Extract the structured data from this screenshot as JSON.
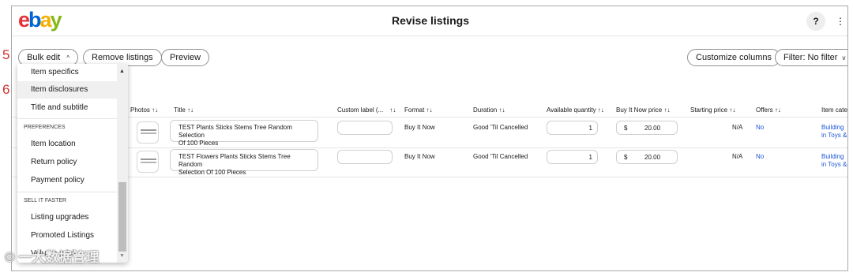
{
  "steps": [
    "5",
    "6"
  ],
  "header": {
    "logo": {
      "e": "e",
      "b": "b",
      "a": "a",
      "y": "y"
    },
    "title": "Revise listings",
    "help_label": "?",
    "more_label": "⋮"
  },
  "toolbar": {
    "bulk_edit": "Bulk edit",
    "bulk_edit_caret": "^",
    "remove_listings": "Remove listings",
    "preview": "Preview",
    "customize_columns": "Customize columns",
    "filter": "Filter: No filter",
    "filter_caret": "v"
  },
  "columns": {
    "photos": "Photos ↑↓",
    "title": "Title ↑↓",
    "custom_label": "Custom label (...",
    "custom_label_sort": "↑↓",
    "format": "Format ↑↓",
    "duration": "Duration ↑↓",
    "available_quantity": "Available quantity ↑↓",
    "buy_it_now_price": "Buy It Now price ↑↓",
    "starting_price": "Starting price ↑↓",
    "offers": "Offers ↑↓",
    "item_category": "Item categ"
  },
  "rows": [
    {
      "title_line1": "TEST Plants Sticks Stems Tree Random Selection",
      "title_line2": "Of 100 Pieces",
      "custom_label": "",
      "format": "Buy It Now",
      "duration": "Good 'Til Cancelled",
      "quantity": "1",
      "currency": "$",
      "price": "20.00",
      "starting_price": "N/A",
      "offers": "No",
      "category_line1": "Building",
      "category_line2": "in Toys &"
    },
    {
      "title_line1": "TEST Flowers Plants Sticks Stems Tree Random",
      "title_line2": "Selection Of 100 Pieces",
      "custom_label": "",
      "format": "Buy It Now",
      "duration": "Good 'Til Cancelled",
      "quantity": "1",
      "currency": "$",
      "price": "20.00",
      "starting_price": "N/A",
      "offers": "No",
      "category_line1": "Building",
      "category_line2": "in Toys &"
    }
  ],
  "dropdown": {
    "items_top": [
      "Item specifics",
      "Item disclosures",
      "Title and subtitle"
    ],
    "section_preferences": "PREFERENCES",
    "preferences": [
      "Item location",
      "Return policy",
      "Payment policy"
    ],
    "section_sell_faster": "SELL IT FASTER",
    "sell_faster": [
      "Listing upgrades",
      "Promoted Listings",
      "Volume pricing"
    ]
  },
  "watermark": "© 一大数据管理",
  "colors": {
    "link": "#1a56d6",
    "step": "#d0312d",
    "ebay_red": "#e53238",
    "ebay_blue": "#0064d2",
    "ebay_yellow": "#f5af02",
    "ebay_green": "#86b817"
  }
}
